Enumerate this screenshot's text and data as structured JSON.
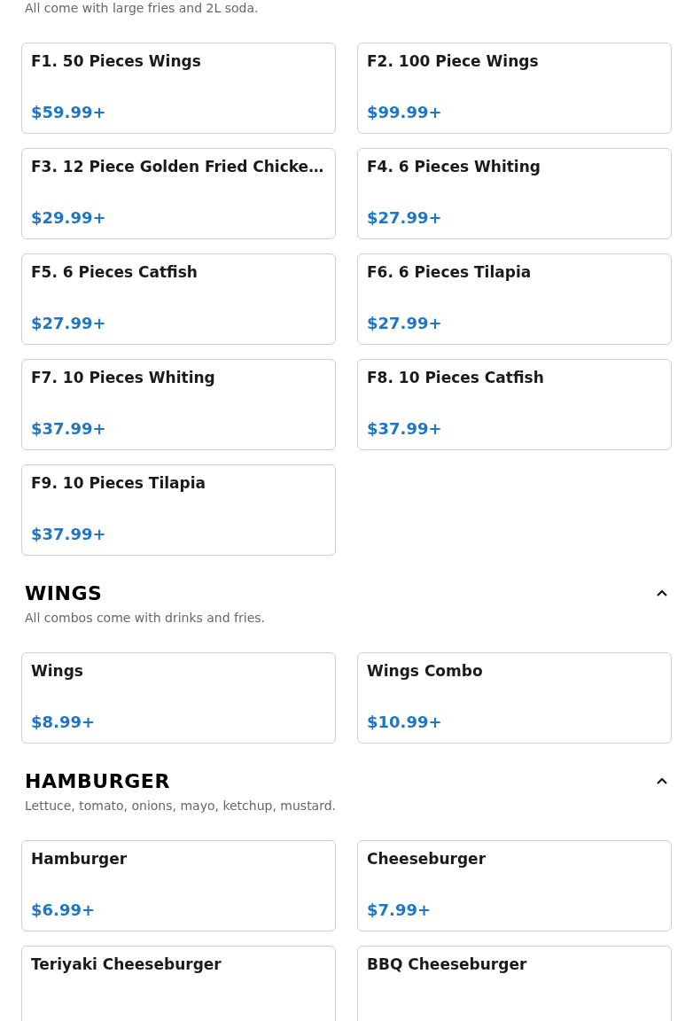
{
  "sections": [
    {
      "description": "All come with large fries and 2L soda.",
      "items": [
        {
          "name": "F1. 50 Pieces Wings",
          "price": "$59.99+"
        },
        {
          "name": "F2. 100 Piece Wings",
          "price": "$99.99+"
        },
        {
          "name": "F3. 12 Piece Golden Fried Chicke…",
          "price": "$29.99+"
        },
        {
          "name": "F4. 6 Pieces Whiting",
          "price": "$27.99+"
        },
        {
          "name": "F5. 6 Pieces Catfish",
          "price": "$27.99+"
        },
        {
          "name": "F6. 6 Pieces Tilapia",
          "price": "$27.99+"
        },
        {
          "name": "F7. 10 Pieces Whiting",
          "price": "$37.99+"
        },
        {
          "name": "F8. 10 Pieces Catfish",
          "price": "$37.99+"
        },
        {
          "name": "F9. 10 Pieces Tilapia",
          "price": "$37.99+"
        }
      ]
    },
    {
      "title": "WINGS",
      "expanded": true,
      "description": "All combos come with drinks and fries.",
      "items": [
        {
          "name": "Wings",
          "price": "$8.99+"
        },
        {
          "name": "Wings Combo",
          "price": "$10.99+"
        }
      ]
    },
    {
      "title": "HAMBURGER",
      "expanded": true,
      "description": "Lettuce, tomato, onions, mayo, ketchup, mustard.",
      "items": [
        {
          "name": "Hamburger",
          "price": "$6.99+"
        },
        {
          "name": "Cheeseburger",
          "price": "$7.99+"
        },
        {
          "name": "Teriyaki Cheeseburger"
        },
        {
          "name": "BBQ Cheeseburger"
        }
      ]
    }
  ]
}
